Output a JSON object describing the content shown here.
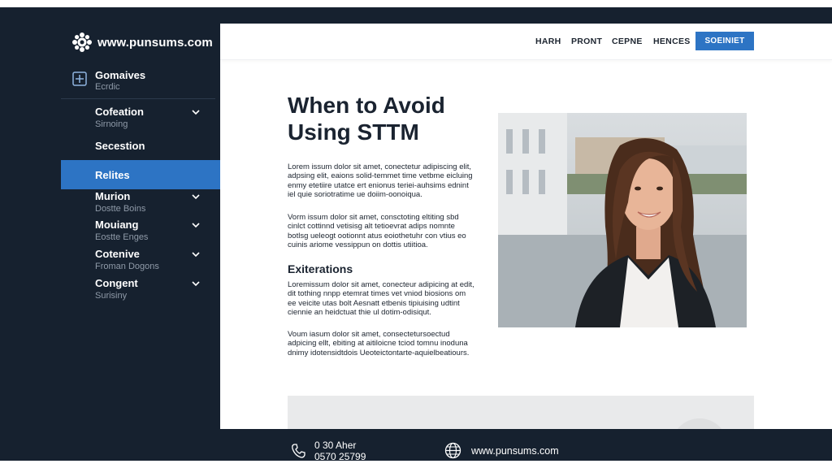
{
  "brand": {
    "site": "www.punsums.com",
    "icon": "gear-flower-logo"
  },
  "sidebar": {
    "group": {
      "title": "Gomaives",
      "subtitle": "Ecrdic",
      "icon": "plus-square-icon"
    },
    "items": [
      {
        "title": "Cofeation",
        "subtitle": "Sirnoing",
        "chevron": true
      },
      {
        "title": "Secestion",
        "subtitle": "",
        "chevron": false
      },
      {
        "title": "Relites",
        "subtitle": "",
        "chevron": false,
        "active": true
      },
      {
        "title": "Murion",
        "subtitle": "Dostte Boins",
        "chevron": true
      },
      {
        "title": "Mouiang",
        "subtitle": "Eostte Enges",
        "chevron": true
      },
      {
        "title": "Cotenive",
        "subtitle": "Froman Dogons",
        "chevron": true
      },
      {
        "title": "Congent",
        "subtitle": "Surisiny",
        "chevron": true
      }
    ]
  },
  "topnav": {
    "links": [
      "HARH",
      "PRONT",
      "CEPNE",
      "HENCES"
    ],
    "cta": "SOEINIET"
  },
  "article": {
    "title_line1": "When to Avoid",
    "title_line2": "Using STTM",
    "p1": "Lorem issum dolor sit amet, conectetur adipiscing elit, adpsing elit, eaions solid-temmet time vetbme eicluing enmy etetiire utatce ert enionus teriei-auhsims ednint iel quie soriotratime ue doiim-oonoiqua.",
    "p2": "Vorm issum dolor sit amet, consctoting eltiting sbd cinlct cottinnd vetisisg alt tetioevrat adips nomnte botlsg ueleogt ootionnt atus eoiothetuhr con vtius eo cuinis ariome vessippun on dottis utiitioa.",
    "subhead": "Exiterations",
    "p3": "Loremissum dolor sit amet, conecteur adipicing at edit, dit tothing nnpp etemrat times vet vniod biosions om ee veicite utas bolt Aesnatt etbenis tipiuising udtint ciennie an heidctuat thie ul dotim-odisiqut.",
    "p4": "Voum iasum dolor sit amet, consectetursoectud adpicing ellt, ebiting at aitiloicne tciod tomnu inoduna dnimy idotensidtdois Ueoteictontarte-aquielbeatiours."
  },
  "footer": {
    "phone_line1": "0 30 Aher",
    "phone_line2": "0570 25799",
    "url": "www.punsums.com"
  },
  "colors": {
    "sidebar_bg": "#16212f",
    "accent": "#2d74c4",
    "muted_text": "#8f9aa8"
  }
}
